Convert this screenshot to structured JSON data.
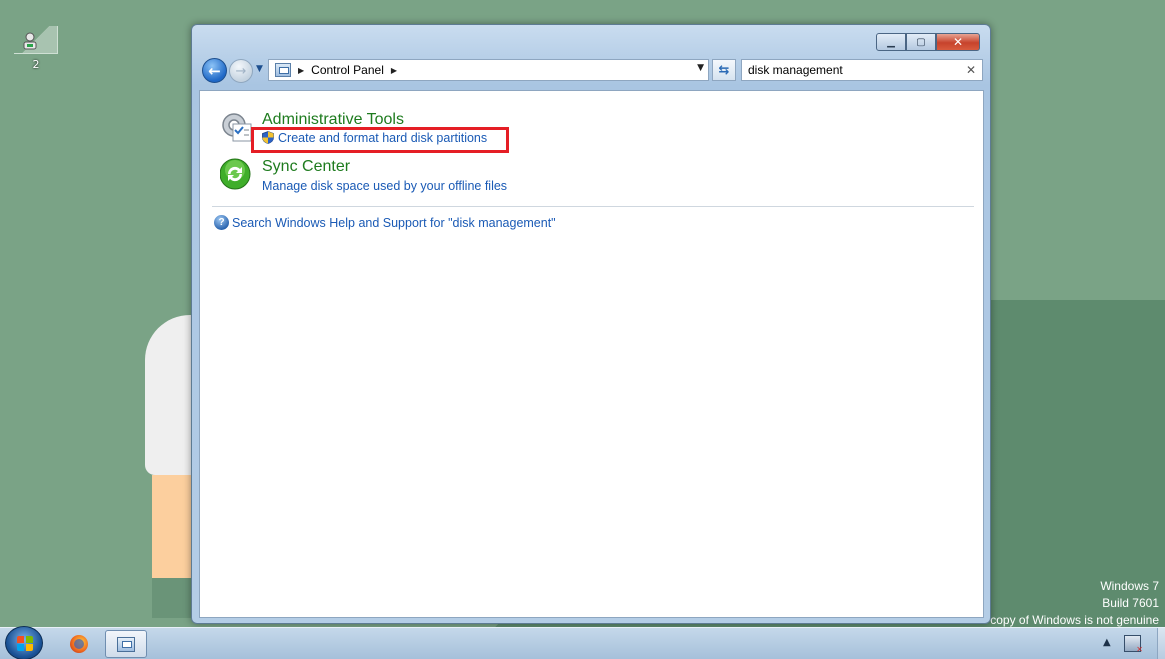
{
  "desktop": {
    "icon_label": "2",
    "watermark": {
      "line1": "Windows 7",
      "line2": "Build 7601",
      "line3": "copy of Windows is not genuine"
    }
  },
  "window": {
    "caption": {
      "minimize": "▁",
      "maximize": "▢",
      "close": "✕"
    },
    "address": {
      "crumbs": [
        "Control Panel"
      ]
    },
    "search": {
      "value": "disk management"
    },
    "results": [
      {
        "title": "Administrative Tools",
        "icon": "administrative-tools-icon",
        "link": "Create and format hard disk partitions",
        "link_icon": "uac-shield-icon"
      },
      {
        "title": "Sync Center",
        "icon": "sync-center-icon",
        "link": "Manage disk space used by your offline files"
      }
    ],
    "help_link": "Search Windows Help and Support for \"disk management\""
  },
  "colors": {
    "highlight": "#e51e25",
    "result_title": "#1e7b1e",
    "link": "#1a5ab5"
  }
}
